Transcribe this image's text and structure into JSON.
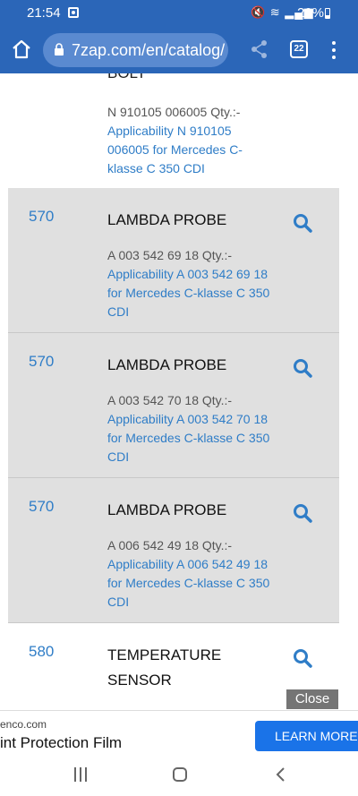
{
  "status": {
    "time": "21:54",
    "battery": "29%"
  },
  "browser": {
    "url": "7zap.com/en/catalog/",
    "tab_count": "22"
  },
  "partial_item": {
    "title_fragment": "BOLT",
    "qty_line": "N 910105 006005 Qty.:-",
    "applicability": "Applicability N 910105 006005 for Mercedes C-klasse C 350 CDI"
  },
  "items": [
    {
      "number": "570",
      "name": "LAMBDA PROBE",
      "qty_line": "A 003 542 69 18 Qty.:-",
      "applicability": "Applicability A 003 542 69 18 for Mercedes C-klasse C 350 CDI"
    },
    {
      "number": "570",
      "name": "LAMBDA PROBE",
      "qty_line": "A 003 542 70 18 Qty.:-",
      "applicability": "Applicability A 003 542 70 18 for Mercedes C-klasse C 350 CDI"
    },
    {
      "number": "570",
      "name": "LAMBDA PROBE",
      "qty_line": "A 006 542 49 18 Qty.:-",
      "applicability": "Applicability A 006 542 49 18 for Mercedes C-klasse C 350 CDI"
    },
    {
      "number": "580",
      "name": "TEMPERATURE SENSOR"
    }
  ],
  "ad": {
    "close_label": "Close",
    "domain": "enco.com",
    "headline": "int Protection Film",
    "cta": "LEARN MORE"
  },
  "colors": {
    "accent": "#2b66b8",
    "link": "#2f7dc7",
    "row_bg": "#e0e0e0",
    "cta": "#1a73e8"
  }
}
